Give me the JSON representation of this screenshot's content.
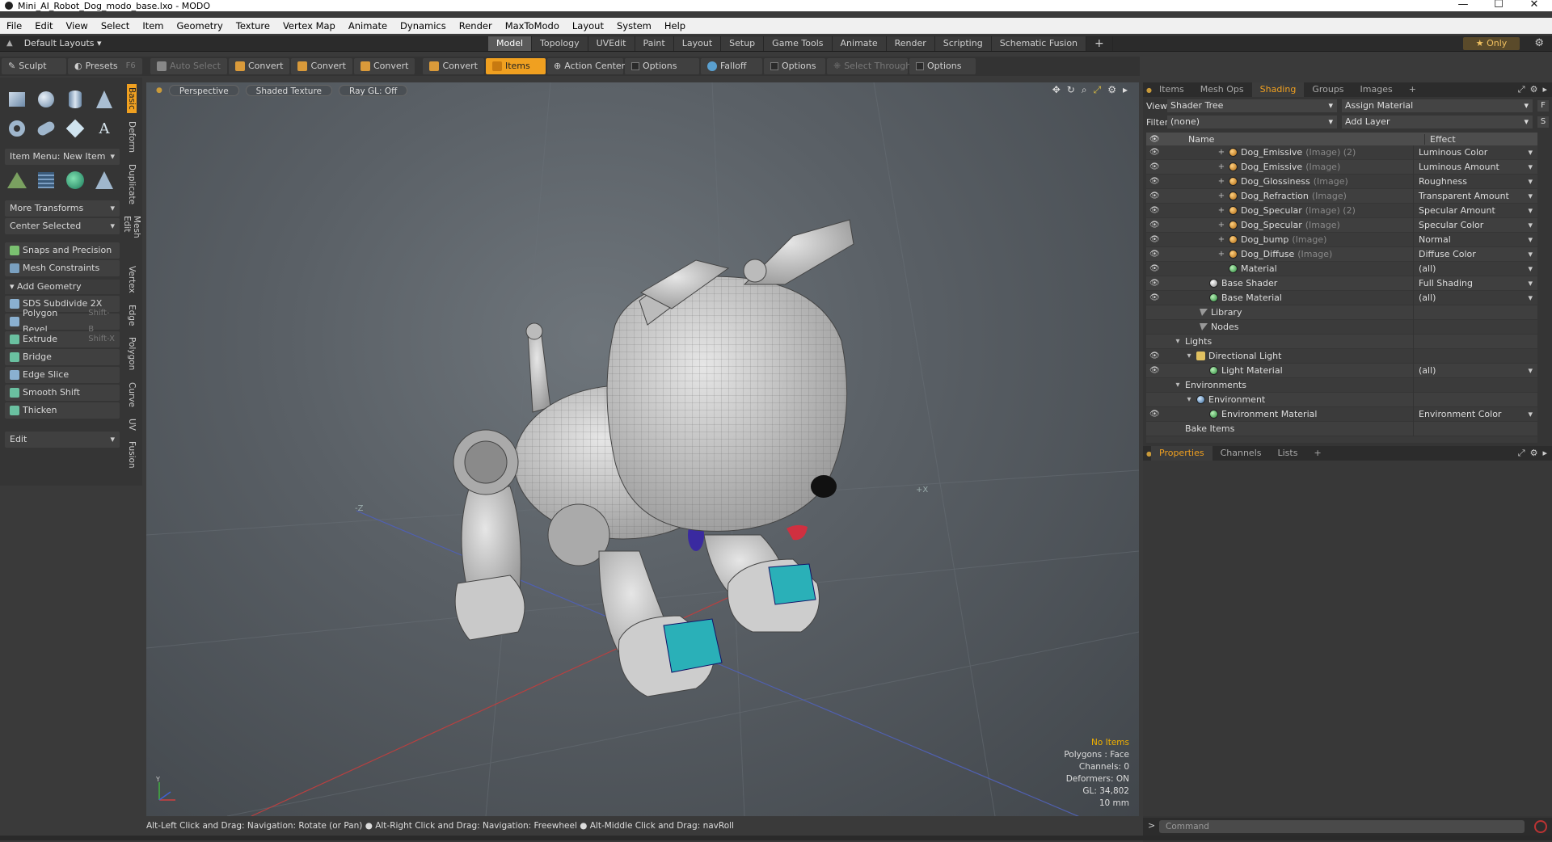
{
  "window": {
    "title": "Mini_AI_Robot_Dog_modo_base.lxo - MODO",
    "minimize": "—",
    "maximize": "☐",
    "close": "✕"
  },
  "menu": [
    "File",
    "Edit",
    "View",
    "Select",
    "Item",
    "Geometry",
    "Texture",
    "Vertex Map",
    "Animate",
    "Dynamics",
    "Render",
    "MaxToModo",
    "Layout",
    "System",
    "Help"
  ],
  "layoutbar": {
    "layout_dropdown": "Default Layouts",
    "tabs": [
      "Model",
      "Topology",
      "UVEdit",
      "Paint",
      "Layout",
      "Setup",
      "Game Tools",
      "Animate",
      "Render",
      "Scripting",
      "Schematic Fusion"
    ],
    "active_tab": "Model",
    "plus": "+",
    "only_label": "Only",
    "star": "★"
  },
  "toolbar": {
    "sculpt": "Sculpt",
    "presets": "Presets",
    "presets_key": "F6",
    "auto_select": "Auto Select",
    "convert1": "Convert",
    "convert2": "Convert",
    "convert3": "Convert",
    "convert4": "Convert",
    "items": "Items",
    "action_center": "Action Center",
    "options1": "Options",
    "falloff": "Falloff",
    "options2": "Options",
    "select_through": "Select Through",
    "options3": "Options"
  },
  "leftpanel": {
    "item_menu": "Item Menu: New Item",
    "more_transforms": "More Transforms",
    "center_selected": "Center Selected",
    "snaps": "Snaps and Precision",
    "mesh_constraints": "Mesh Constraints",
    "add_geometry": "Add Geometry",
    "tools": [
      {
        "label": "SDS Subdivide 2X",
        "key": ""
      },
      {
        "label": "Polygon Bevel",
        "key": "Shift-B"
      },
      {
        "label": "Extrude",
        "key": "Shift-X"
      },
      {
        "label": "Bridge",
        "key": ""
      },
      {
        "label": "Edge Slice",
        "key": ""
      },
      {
        "label": "Smooth Shift",
        "key": ""
      },
      {
        "label": "Thicken",
        "key": ""
      }
    ],
    "edit": "Edit",
    "vtabs": [
      "Basic",
      "Deform",
      "Duplicate",
      "Mesh Edit",
      "Vertex",
      "Edge",
      "Polygon",
      "Curve",
      "UV",
      "Fusion"
    ]
  },
  "viewport": {
    "perspective": "Perspective",
    "shaded_texture": "Shaded Texture",
    "raygl": "Ray GL: Off",
    "info": {
      "no_items": "No Items",
      "polygons": "Polygons : Face",
      "channels": "Channels: 0",
      "deformers": "Deformers: ON",
      "gl": "GL: 34,802",
      "scale": "10 mm"
    },
    "axis_labels": {
      "z": "-Z",
      "x": "+X",
      "y": "Y"
    }
  },
  "statusbar": "Alt-Left Click and Drag: Navigation: Rotate (or Pan) ● Alt-Right Click and Drag: Navigation: Freewheel ● Alt-Middle Click and Drag: navRoll",
  "rightpanel": {
    "tabs": [
      "Items",
      "Mesh Ops",
      "Shading",
      "Groups",
      "Images"
    ],
    "active_tab": "Shading",
    "plus": "+",
    "view_label": "View",
    "view_value": "Shader Tree",
    "assign_material": "Assign Material",
    "filter_label": "Filter",
    "filter_value": "(none)",
    "add_layer": "Add Layer",
    "f_btn": "F",
    "s_btn": "S",
    "col_name": "Name",
    "col_effect": "Effect",
    "rows": [
      {
        "name": "Dog_Emissive",
        "sub": "(Image) (2)",
        "effect": "Luminous Color",
        "type": "img",
        "indent": 54,
        "exp": "+",
        "eye": true
      },
      {
        "name": "Dog_Emissive",
        "sub": "(Image)",
        "effect": "Luminous Amount",
        "type": "img",
        "indent": 54,
        "exp": "+",
        "eye": true
      },
      {
        "name": "Dog_Glossiness",
        "sub": "(Image)",
        "effect": "Roughness",
        "type": "img",
        "indent": 54,
        "exp": "+",
        "eye": true
      },
      {
        "name": "Dog_Refraction",
        "sub": "(Image)",
        "effect": "Transparent Amount",
        "type": "img",
        "indent": 54,
        "exp": "+",
        "eye": true
      },
      {
        "name": "Dog_Specular",
        "sub": "(Image) (2)",
        "effect": "Specular Amount",
        "type": "img",
        "indent": 54,
        "exp": "+",
        "eye": true
      },
      {
        "name": "Dog_Specular",
        "sub": "(Image)",
        "effect": "Specular Color",
        "type": "img",
        "indent": 54,
        "exp": "+",
        "eye": true
      },
      {
        "name": "Dog_bump",
        "sub": "(Image)",
        "effect": "Normal",
        "type": "img",
        "indent": 54,
        "exp": "+",
        "eye": true
      },
      {
        "name": "Dog_Diffuse",
        "sub": "(Image)",
        "effect": "Diffuse Color",
        "type": "img",
        "indent": 54,
        "exp": "+",
        "eye": true
      },
      {
        "name": "Material",
        "sub": "",
        "effect": "(all)",
        "type": "mat",
        "indent": 54,
        "exp": "",
        "eye": true
      },
      {
        "name": "Base Shader",
        "sub": "",
        "effect": "Full Shading",
        "type": "shader",
        "indent": 30,
        "exp": "",
        "eye": true
      },
      {
        "name": "Base Material",
        "sub": "",
        "effect": "(all)",
        "type": "mat",
        "indent": 30,
        "exp": "",
        "eye": true
      },
      {
        "name": "Library",
        "sub": "",
        "effect": "",
        "type": "folder",
        "indent": 18,
        "exp": "",
        "eye": false
      },
      {
        "name": "Nodes",
        "sub": "",
        "effect": "",
        "type": "folder",
        "indent": 18,
        "exp": "",
        "eye": false
      },
      {
        "name": "Lights",
        "sub": "",
        "effect": "",
        "type": "none",
        "indent": 0,
        "exp": "▾",
        "eye": false
      },
      {
        "name": "Directional Light",
        "sub": "",
        "effect": "",
        "type": "light",
        "indent": 14,
        "exp": "▾",
        "eye": true
      },
      {
        "name": "Light Material",
        "sub": "",
        "effect": "(all)",
        "type": "mat",
        "indent": 30,
        "exp": "",
        "eye": true
      },
      {
        "name": "Environments",
        "sub": "",
        "effect": "",
        "type": "none",
        "indent": 0,
        "exp": "▾",
        "eye": false
      },
      {
        "name": "Environment",
        "sub": "",
        "effect": "",
        "type": "env",
        "indent": 14,
        "exp": "▾",
        "eye": false
      },
      {
        "name": "Environment Material",
        "sub": "",
        "effect": "Environment Color",
        "type": "mat",
        "indent": 30,
        "exp": "",
        "eye": true
      },
      {
        "name": "Bake Items",
        "sub": "",
        "effect": "",
        "type": "none",
        "indent": 0,
        "exp": "",
        "eye": false
      }
    ],
    "prop_tabs": [
      "Properties",
      "Channels",
      "Lists"
    ],
    "prop_active": "Properties",
    "prop_plus": "+"
  },
  "command": {
    "placeholder": "Command",
    "arrow": ">"
  },
  "colors": {
    "accent": "#f0a020",
    "panel": "#353535",
    "viewport_center": "#6e757b",
    "highlight_text": "#f0b000"
  }
}
